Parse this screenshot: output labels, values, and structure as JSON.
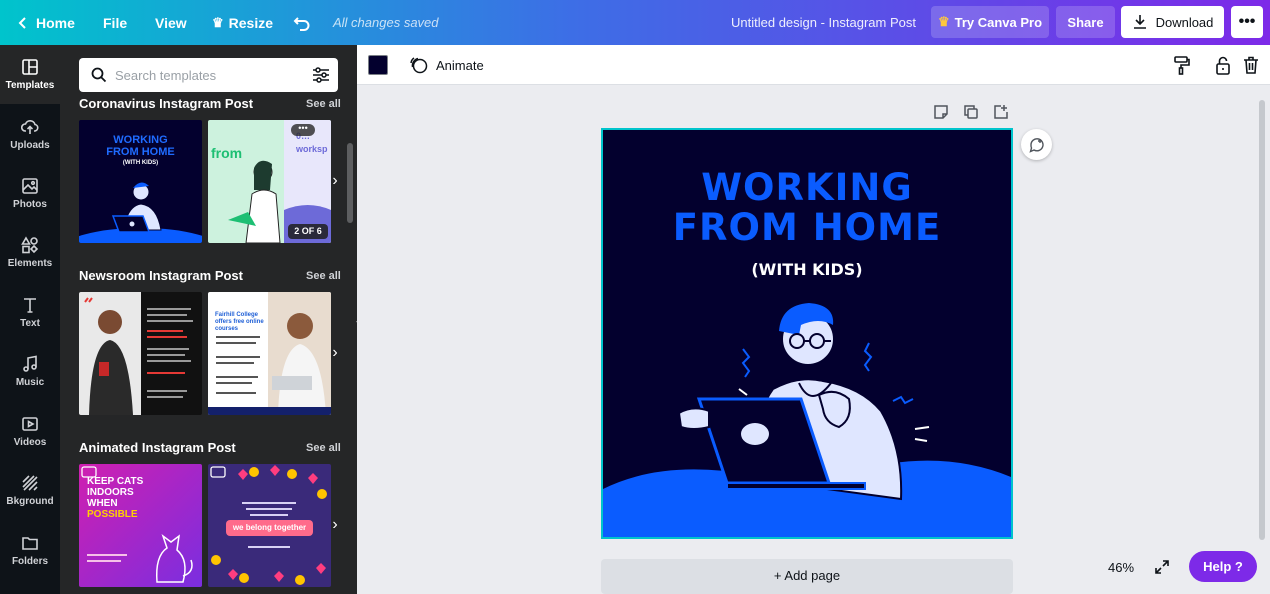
{
  "topbar": {
    "home": "Home",
    "file": "File",
    "view": "View",
    "resize": "Resize",
    "saved_status": "All changes saved",
    "doc_title": "Untitled design - Instagram Post",
    "try_pro": "Try Canva Pro",
    "share": "Share",
    "download": "Download",
    "more": "•••"
  },
  "rail": {
    "items": [
      {
        "label": "Templates",
        "icon": "templates-icon"
      },
      {
        "label": "Uploads",
        "icon": "upload-icon"
      },
      {
        "label": "Photos",
        "icon": "photo-icon"
      },
      {
        "label": "Elements",
        "icon": "shapes-icon"
      },
      {
        "label": "Text",
        "icon": "text-icon"
      },
      {
        "label": "Music",
        "icon": "music-icon"
      },
      {
        "label": "Videos",
        "icon": "video-icon"
      },
      {
        "label": "Bkground",
        "icon": "background-icon"
      },
      {
        "label": "Folders",
        "icon": "folder-icon"
      }
    ]
  },
  "panel": {
    "search_placeholder": "Search templates",
    "see_all": "See all",
    "sections": [
      {
        "title": "Coronavirus Instagram Post",
        "thumb1_lines": [
          "WORKING",
          "FROM HOME",
          "(WITH KIDS)"
        ],
        "thumb2_text": "from",
        "thumb2_badge": "2 OF 6",
        "thumb2_side": "0… worksp"
      },
      {
        "title": "Newsroom Instagram Post",
        "thumb2_heading": "Fairhill College offers free online courses"
      },
      {
        "title": "Animated Instagram Post",
        "thumb1_lines": [
          "KEEP CATS",
          "INDOORS",
          "WHEN",
          "POSSIBLE"
        ],
        "thumb2_pill": "we belong together"
      }
    ]
  },
  "context": {
    "color": "#03002e",
    "animate": "Animate"
  },
  "design": {
    "title_line1": "WORKING",
    "title_line2": "FROM HOME",
    "subtitle": "(WITH KIDS)",
    "bg_color": "#03002e",
    "accent_color": "#0a5cff"
  },
  "canvas": {
    "add_page": "+ Add page",
    "zoom": "46%",
    "help": "Help ?"
  }
}
